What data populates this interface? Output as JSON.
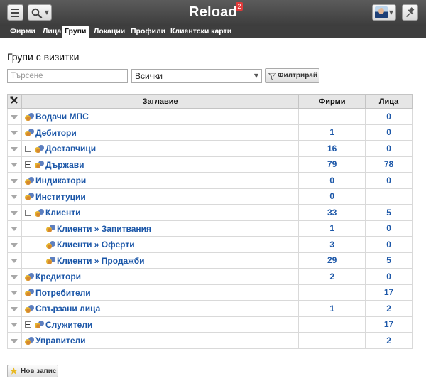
{
  "app": {
    "brand": "Reload",
    "badge": "2"
  },
  "top_nav": {
    "menu_icon": "hamburger-icon",
    "search_icon": "magnifier-icon",
    "user_icon": "user-avatar",
    "pin_icon": "pin-icon"
  },
  "tabs": [
    {
      "label": "Фирми",
      "active": false
    },
    {
      "label": "Лица",
      "active": false
    },
    {
      "label": "Групи",
      "active": true
    },
    {
      "label": "Локации",
      "active": false
    },
    {
      "label": "Профили",
      "active": false
    },
    {
      "label": "Клиентски карти",
      "active": false
    }
  ],
  "page": {
    "title": "Групи с визитки"
  },
  "filters": {
    "search_placeholder": "Търсене",
    "select_value": "Всички",
    "filter_label": "Филтрирай"
  },
  "table": {
    "columns": {
      "title": "Заглавие",
      "companies": "Фирми",
      "persons": "Лица"
    },
    "header_icon": "tools-icon",
    "rows": [
      {
        "title": "Водачи МПС",
        "companies": "",
        "persons": "0",
        "level": 0,
        "expander": ""
      },
      {
        "title": "Дебитори",
        "companies": "1",
        "persons": "0",
        "level": 0,
        "expander": ""
      },
      {
        "title": "Доставчици",
        "companies": "16",
        "persons": "0",
        "level": 0,
        "expander": "plus"
      },
      {
        "title": "Държави",
        "companies": "79",
        "persons": "78",
        "level": 0,
        "expander": "plus"
      },
      {
        "title": "Индикатори",
        "companies": "0",
        "persons": "0",
        "level": 0,
        "expander": ""
      },
      {
        "title": "Институции",
        "companies": "0",
        "persons": "",
        "level": 0,
        "expander": ""
      },
      {
        "title": "Клиенти",
        "companies": "33",
        "persons": "5",
        "level": 0,
        "expander": "minus"
      },
      {
        "title": "Клиенти » Запитвания",
        "companies": "1",
        "persons": "0",
        "level": 1,
        "expander": ""
      },
      {
        "title": "Клиенти » Оферти",
        "companies": "3",
        "persons": "0",
        "level": 1,
        "expander": ""
      },
      {
        "title": "Клиенти » Продажби",
        "companies": "29",
        "persons": "5",
        "level": 1,
        "expander": ""
      },
      {
        "title": "Кредитори",
        "companies": "2",
        "persons": "0",
        "level": 0,
        "expander": ""
      },
      {
        "title": "Потребители",
        "companies": "",
        "persons": "17",
        "level": 0,
        "expander": ""
      },
      {
        "title": "Свързани лица",
        "companies": "1",
        "persons": "2",
        "level": 0,
        "expander": ""
      },
      {
        "title": "Служители",
        "companies": "",
        "persons": "17",
        "level": 0,
        "expander": "plus"
      },
      {
        "title": "Управители",
        "companies": "",
        "persons": "2",
        "level": 0,
        "expander": ""
      }
    ]
  },
  "actions": {
    "new_record": "Нов запис",
    "new_icon": "star-icon"
  },
  "colors": {
    "link": "#1c57a8",
    "topbar": "#3e3e3e"
  }
}
